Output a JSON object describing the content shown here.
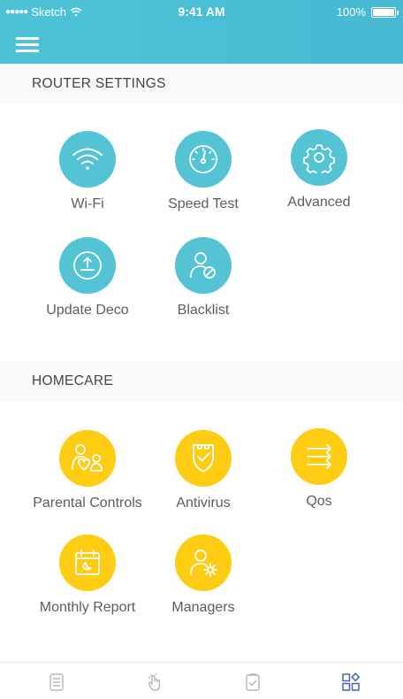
{
  "status_bar": {
    "carrier": "Sketch",
    "time": "9:41 AM",
    "battery_percent_label": "100%",
    "battery_level": 1.0
  },
  "header": {
    "menu_icon": "hamburger-menu-icon"
  },
  "colors": {
    "header": "#4ec3d6",
    "teal_tile": "#54c3d3",
    "yellow_tile": "#ffcc14",
    "tab_active": "#4b63a8",
    "tab_inactive": "#b5b5b5"
  },
  "router_settings": {
    "title": "ROUTER SETTINGS",
    "items": [
      {
        "label": "Wi-Fi",
        "icon": "wifi-icon"
      },
      {
        "label": "Speed Test",
        "icon": "speedometer-icon"
      },
      {
        "label": "Advanced",
        "icon": "gear-icon"
      },
      {
        "label": "Update Deco",
        "icon": "upload-icon"
      },
      {
        "label": "Blacklist",
        "icon": "user-blocked-icon"
      }
    ]
  },
  "homecare": {
    "title": "HOMECARE",
    "items": [
      {
        "label": "Parental Controls",
        "icon": "family-icon"
      },
      {
        "label": "Antivirus",
        "icon": "shield-icon"
      },
      {
        "label": "Qos",
        "icon": "arrows-icon"
      },
      {
        "label": "Monthly Report",
        "icon": "calendar-icon"
      },
      {
        "label": "Managers",
        "icon": "user-gear-icon"
      }
    ]
  },
  "bottom_tabs": [
    {
      "icon": "list-icon",
      "active": false
    },
    {
      "icon": "hand-pointer-icon",
      "active": false
    },
    {
      "icon": "clipboard-check-icon",
      "active": false
    },
    {
      "icon": "grid-icon",
      "active": true
    }
  ]
}
